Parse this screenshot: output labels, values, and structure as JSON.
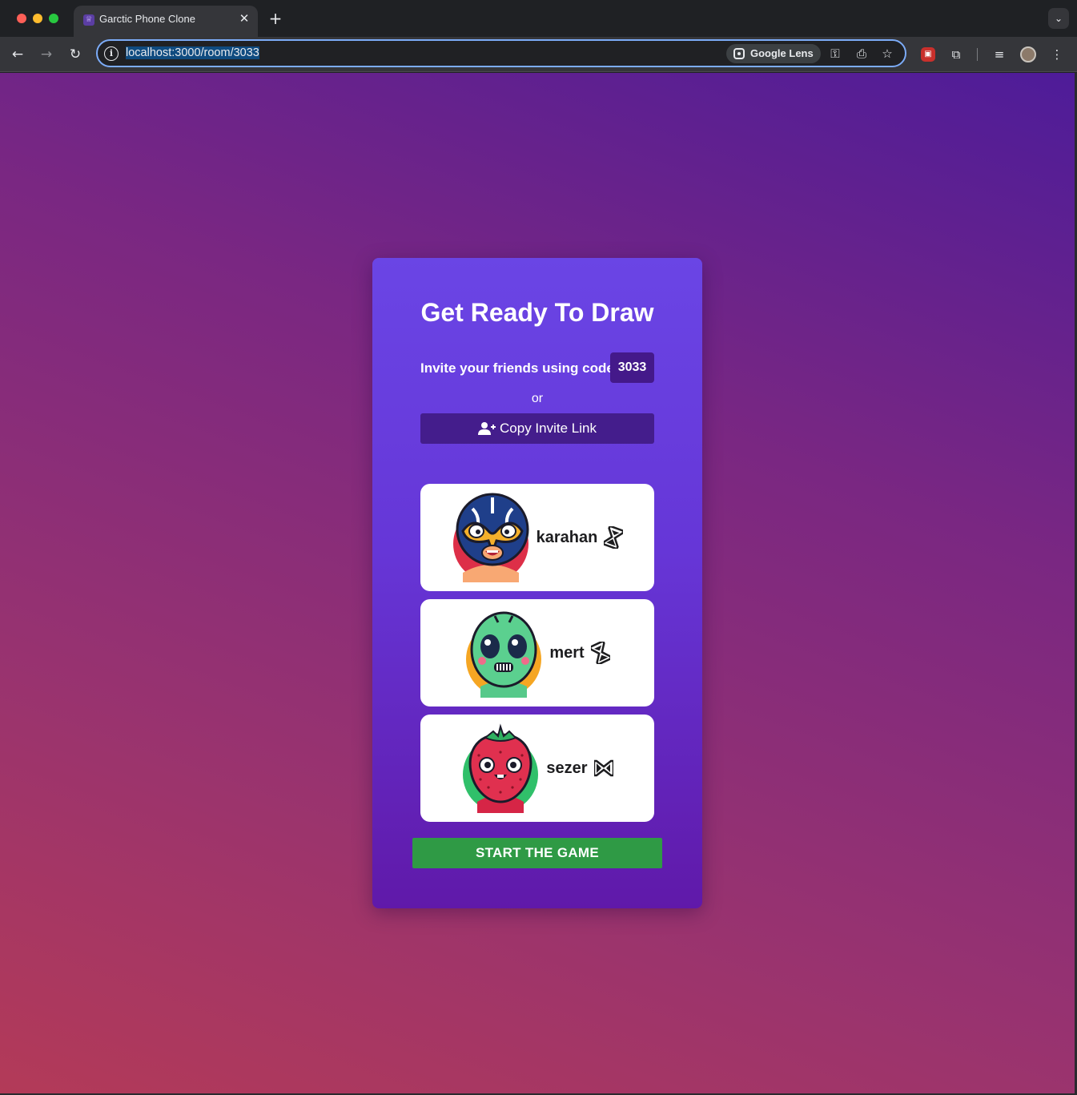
{
  "browser": {
    "tab_title": "Garctic Phone Clone",
    "tab_close": "✕",
    "new_tab": "+",
    "url": "localhost:3000/room/3033",
    "lens_label": "Google Lens"
  },
  "room": {
    "title": "Get Ready To Draw",
    "invite_label": "Invite your friends using code:",
    "code": "3033",
    "or_text": "or",
    "copy_label": "Copy Invite Link",
    "start_label": "START THE GAME"
  },
  "players": [
    {
      "name": "karahan",
      "avatar": "luchador-mask-avatar",
      "status_icon": "hourglass-icon"
    },
    {
      "name": "mert",
      "avatar": "alien-avatar",
      "status_icon": "hourglass-icon"
    },
    {
      "name": "sezer",
      "avatar": "strawberry-avatar",
      "status_icon": "hourglass-sideways-icon"
    }
  ],
  "colors": {
    "card_top": "#6a45e5",
    "card_bottom": "#6019a9",
    "code_badge": "#44198a",
    "start_button": "#2f9a45"
  }
}
